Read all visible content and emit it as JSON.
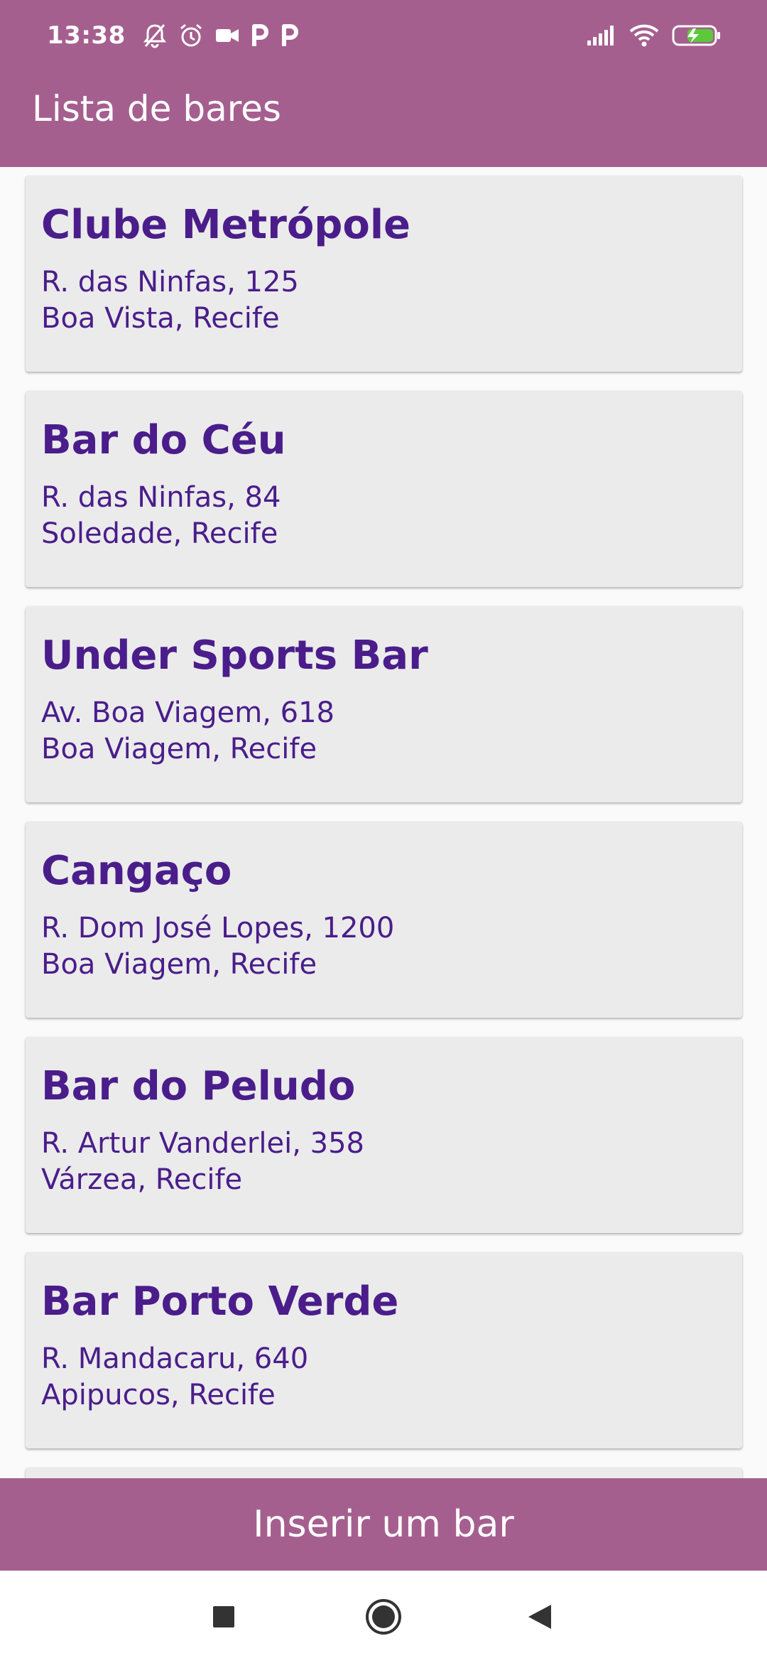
{
  "status_bar": {
    "time": "13:38",
    "left_icons": [
      "bell-off-icon",
      "alarm-icon",
      "video-icon",
      "p-icon",
      "p-icon"
    ],
    "right_icons": [
      "signal-icon",
      "wifi-icon",
      "battery-charging-icon"
    ]
  },
  "app_bar": {
    "title": "Lista de bares"
  },
  "bars": [
    {
      "name": "Clube Metrópole",
      "street": "R. das Ninfas, 125",
      "neighborhood": "Boa Vista, Recife"
    },
    {
      "name": "Bar do Céu",
      "street": "R. das Ninfas, 84",
      "neighborhood": "Soledade, Recife"
    },
    {
      "name": "Under Sports Bar",
      "street": "Av. Boa Viagem, 618",
      "neighborhood": "Boa Viagem, Recife"
    },
    {
      "name": "Cangaço",
      "street": "R. Dom José Lopes, 1200",
      "neighborhood": "Boa Viagem, Recife"
    },
    {
      "name": "Bar do Peludo",
      "street": "R. Artur Vanderlei, 358",
      "neighborhood": "Várzea, Recife"
    },
    {
      "name": "Bar Porto Verde",
      "street": "R. Mandacaru, 640",
      "neighborhood": "Apipucos, Recife"
    }
  ],
  "insert_button": {
    "label": "Inserir um bar"
  },
  "nav_bar": {
    "buttons": [
      "recents-square-icon",
      "home-circle-icon",
      "back-triangle-icon"
    ]
  },
  "colors": {
    "primary": "#a55f8f",
    "card_bg": "#ebebeb",
    "card_text": "#4a1d8b"
  }
}
